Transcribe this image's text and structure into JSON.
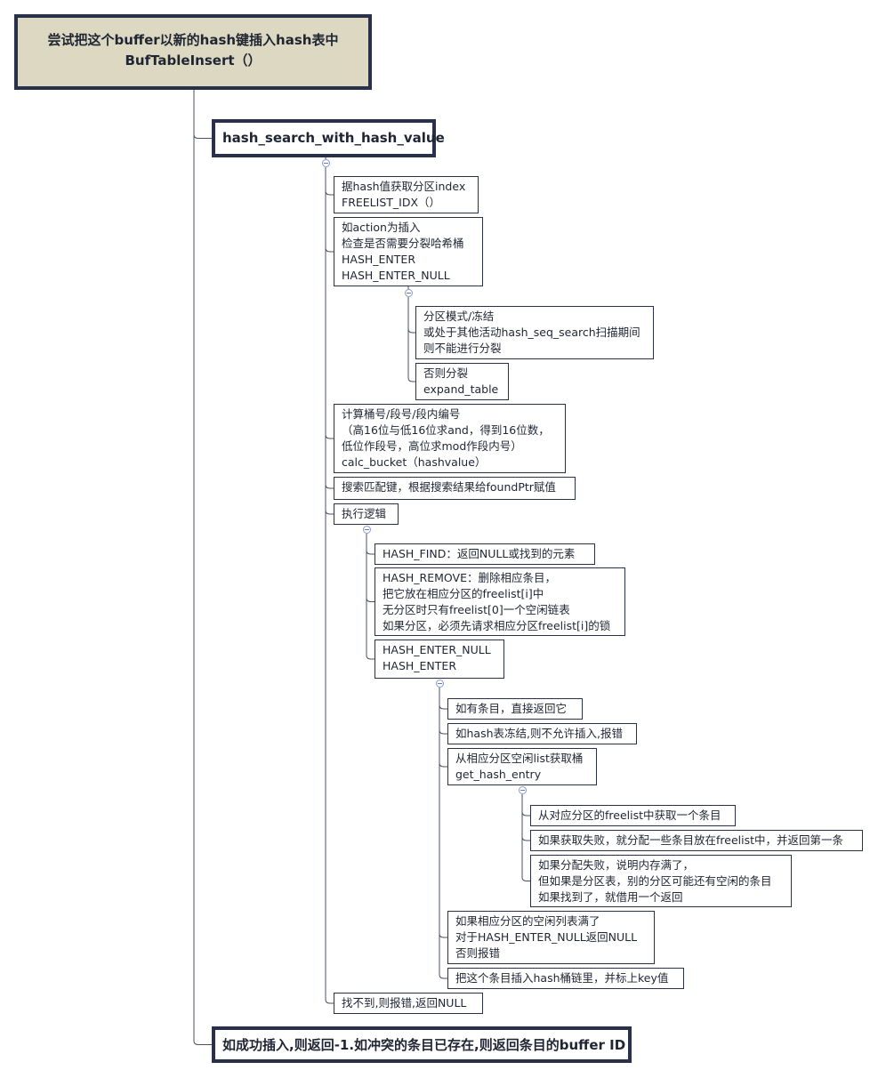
{
  "colors": {
    "border": "#283149",
    "root_fill": "#ddd8c1",
    "connector": "#4a5060"
  },
  "nodes": [
    {
      "id": "root",
      "lines": [
        "尝试把这个buffer以新的hash键插入hash表中",
        "BufTableInsert（）"
      ]
    },
    {
      "id": "hash-search",
      "lines": [
        "hash_search_with_hash_value"
      ]
    },
    {
      "id": "freelist-idx",
      "lines": [
        "据hash值获取分区index",
        "FREELIST_IDX（）"
      ]
    },
    {
      "id": "check-split",
      "lines": [
        "如action为插入",
        "检查是否需要分裂哈希桶",
        "HASH_ENTER",
        "HASH_ENTER_NULL"
      ]
    },
    {
      "id": "no-split",
      "lines": [
        "分区模式/冻结",
        "或处于其他活动hash_seq_search扫描期间",
        "则不能进行分裂"
      ]
    },
    {
      "id": "expand-table",
      "lines": [
        "否则分裂",
        "expand_table"
      ]
    },
    {
      "id": "calc-bucket",
      "lines": [
        "计算桶号/段号/段内编号",
        "（高16位与低16位求and，得到16位数，",
        "低位作段号，高位求mod作段内号）",
        "calc_bucket（hashvalue）"
      ]
    },
    {
      "id": "search-key",
      "lines": [
        "搜索匹配键，根据搜索结果给foundPtr赋值"
      ]
    },
    {
      "id": "exec-logic",
      "lines": [
        "执行逻辑"
      ]
    },
    {
      "id": "hash-find",
      "lines": [
        "HASH_FIND：返回NULL或找到的元素"
      ]
    },
    {
      "id": "hash-remove",
      "lines": [
        "HASH_REMOVE：删除相应条目，",
        "把它放在相应分区的freelist[i]中",
        "无分区时只有freelist[0]一个空闲链表",
        "如果分区，必须先请求相应分区freelist[i]的锁"
      ]
    },
    {
      "id": "hash-enter",
      "lines": [
        "HASH_ENTER_NULL",
        "HASH_ENTER"
      ]
    },
    {
      "id": "return-existing",
      "lines": [
        "如有条目，直接返回它"
      ]
    },
    {
      "id": "frozen-error",
      "lines": [
        "如hash表冻结,则不允许插入,报错"
      ]
    },
    {
      "id": "get-hash-entry",
      "lines": [
        "从相应分区空闲list获取桶",
        "get_hash_entry"
      ]
    },
    {
      "id": "take-freelist",
      "lines": [
        "从对应分区的freelist中获取一个条目"
      ]
    },
    {
      "id": "alloc-entries",
      "lines": [
        "如果获取失败，就分配一些条目放在freelist中，并返回第一条"
      ]
    },
    {
      "id": "borrow-entry",
      "lines": [
        "如果分配失败，说明内存满了，",
        "但如果是分区表，别的分区可能还有空闲的条目",
        "如果找到了，就借用一个返回"
      ]
    },
    {
      "id": "freelist-full",
      "lines": [
        "如果相应分区的空闲列表满了",
        "对于HASH_ENTER_NULL返回NULL",
        "否则报错"
      ]
    },
    {
      "id": "insert-chain",
      "lines": [
        "把这个条目插入hash桶链里，并标上key值"
      ]
    },
    {
      "id": "not-found",
      "lines": [
        "找不到,则报错,返回NULL"
      ]
    },
    {
      "id": "result",
      "lines": [
        "如成功插入,则返回-1.如冲突的条目已存在,则返回条目的buffer ID"
      ]
    }
  ]
}
